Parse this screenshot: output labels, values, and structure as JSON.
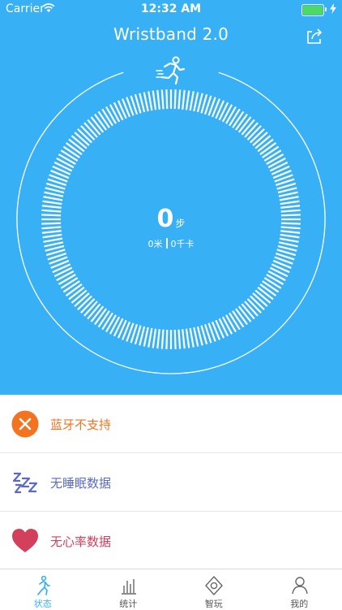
{
  "status_bar": {
    "carrier": "Carrier",
    "time": "12:32 AM"
  },
  "nav": {
    "title": "Wristband 2.0",
    "share_icon": "share-icon"
  },
  "activity": {
    "steps": "0",
    "steps_unit": "步",
    "distance": "0米",
    "calories": "0千卡",
    "icon": "runner-icon"
  },
  "list": [
    {
      "label": "蓝牙不支持",
      "icon": "bluetooth-off-icon",
      "color": "#f37321"
    },
    {
      "label": "无睡眠数据",
      "icon": "sleep-icon",
      "color": "#5b6bc0"
    },
    {
      "label": "无心率数据",
      "icon": "heart-icon",
      "color": "#d2405c"
    }
  ],
  "tabs": [
    {
      "label": "状态",
      "icon": "walk-icon",
      "active": true
    },
    {
      "label": "统计",
      "icon": "bar-chart-icon",
      "active": false
    },
    {
      "label": "智玩",
      "icon": "diamond-icon",
      "active": false
    },
    {
      "label": "我的",
      "icon": "profile-icon",
      "active": false
    }
  ],
  "colors": {
    "primary": "#37b0f5",
    "battery": "#4cd964",
    "tab_active": "#37b0f5",
    "tab_inactive": "#555555"
  }
}
